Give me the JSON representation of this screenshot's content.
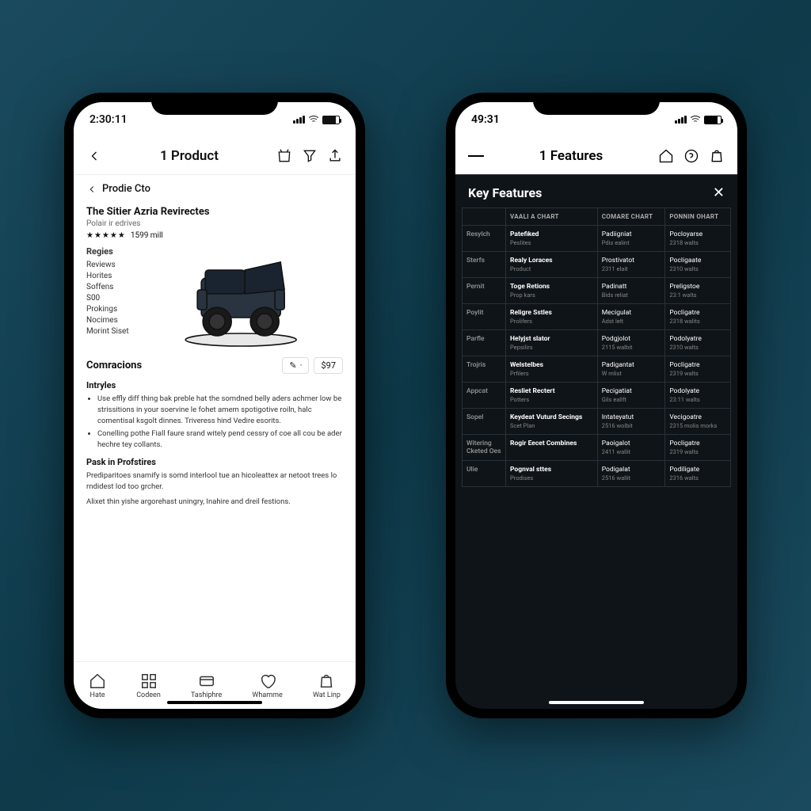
{
  "phone1": {
    "statusTime": "2:30:11",
    "headerTitle": "1 Product",
    "breadcrumb": "Prodie Cto",
    "productTitle": "The Sitier Azria Revirectes",
    "productSub": "Polair ir edrives",
    "ratingStars": "★★★★★",
    "ratingCount": "1599 mill",
    "tagsTitle": "Regies",
    "tags": [
      "Reviews",
      "Horites",
      "Soffens",
      "S00",
      "Prokings",
      "Nocimes",
      "Morint Siset"
    ],
    "comparisonsTitle": "Comracions",
    "editIcon": "✎",
    "price": "$97",
    "intrivlesTitle": "Intryles",
    "bullets": [
      "Use effly diff thing bak preble hat the somdned belly aders achmer low be strissitions in your soervine le fohet amem spotigotive roiln, halc comentisal ksgolt dinnes. Triveress hind Vedire esorits.",
      "Conelling pothe Fiall faure srand witely pend cessry of coe all cou be ader hechre tey collants."
    ],
    "paskTitle": "Pask in Profstires",
    "paskBody1": "Prediparitoes snamify is somd interlool tue an hicoleattex ar netoot trees lo rndidest lod too grcher.",
    "paskBody2": "Alixet thin yishe argorehast uningry, Inahire and dreil festions.",
    "tabs": [
      "Hate",
      "Codeen",
      "Tashiphre",
      "Whamme",
      "Wat Linp"
    ]
  },
  "phone2": {
    "statusTime": "49:31",
    "headerTitle": "1 Features",
    "panelTitle": "Key Features",
    "columns": [
      "",
      "VAALI A CHART",
      "COMARE CHART",
      "PONNIN OHART"
    ],
    "rows": [
      {
        "label": "Resylch",
        "feat": "Patefiked",
        "featSub": "Peslites",
        "c2": "Padiigniat",
        "c2sub": "Pdis ealint",
        "c3": "Pocloyarse",
        "c3sub": "2318 walts"
      },
      {
        "label": "Sterfs",
        "feat": "Realy Loraces",
        "featSub": "Product",
        "c2": "Prostivatot",
        "c2sub": "2311 elait",
        "c3": "Pocligaate",
        "c3sub": "2310 walts"
      },
      {
        "label": "Pernit",
        "feat": "Toge Retions",
        "featSub": "Prop kars",
        "c2": "Padinatt",
        "c2sub": "Bids reliat",
        "c3": "Preligstoe",
        "c3sub": "23:1 walts"
      },
      {
        "label": "Poylit",
        "feat": "Religre Sstles",
        "featSub": "Prolifers",
        "c2": "Mecigulat",
        "c2sub": "Adst lelt",
        "c3": "Pocligatre",
        "c3sub": "2318 walits"
      },
      {
        "label": "Parfle",
        "feat": "Helyjst slator",
        "featSub": "Pepsilirs",
        "c2": "Podgjolot",
        "c2sub": "2115 walbit",
        "c3": "Podolyatre",
        "c3sub": "2310 walts"
      },
      {
        "label": "Trojris",
        "feat": "Welstelbes",
        "featSub": "Prfilers",
        "c2": "Padigantat",
        "c2sub": "W mlist",
        "c3": "Pocligatre",
        "c3sub": "2319 walts"
      },
      {
        "label": "Appcat",
        "feat": "Resliet Rectert",
        "featSub": "Potters",
        "c2": "Pecigatiat",
        "c2sub": "Gils eallft",
        "c3": "Podolyate",
        "c3sub": "23:11 walts"
      },
      {
        "label": "Sopel",
        "feat": "Keydeat Vuturd Secings",
        "featSub": "Scet Plan",
        "c2": "Intateyatut",
        "c2sub": "2516 wolbit",
        "c3": "Vecigoatre",
        "c3sub": "2315 molis morks"
      },
      {
        "label": "Witering Cketed Oes",
        "feat": "Rogir Eecet Combines",
        "featSub": "",
        "c2": "Paoigalot",
        "c2sub": "2411 wallit",
        "c3": "Pocligatre",
        "c3sub": "2319 walts"
      },
      {
        "label": "Ulie",
        "feat": "Pognval sttes",
        "featSub": "Prodises",
        "c2": "Podigalat",
        "c2sub": "2516 wallit",
        "c3": "Podiligate",
        "c3sub": "2316 walts"
      }
    ]
  }
}
